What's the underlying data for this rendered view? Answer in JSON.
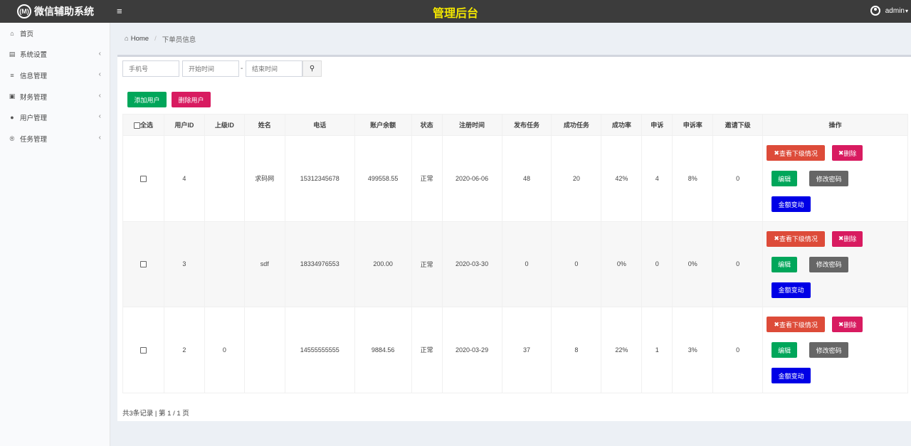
{
  "header": {
    "logo_text": "微信辅助系统",
    "logo_badge": "(M)",
    "title": "管理后台",
    "user": "admin",
    "menu_icon": "hamburger-icon",
    "user_icon": "user-circle-icon",
    "colors": {
      "topbar": "#3c3c3c",
      "title": "#f3e600"
    }
  },
  "sidebar": {
    "items": [
      {
        "label": "首页",
        "icon": "home-icon",
        "has_arrow": false
      },
      {
        "label": "系统设置",
        "icon": "settings-icon",
        "has_arrow": true
      },
      {
        "label": "信息管理",
        "icon": "list-icon",
        "has_arrow": true
      },
      {
        "label": "财务管理",
        "icon": "money-icon",
        "has_arrow": true
      },
      {
        "label": "用户管理",
        "icon": "users-icon",
        "has_arrow": true
      },
      {
        "label": "任务管理",
        "icon": "registered-icon",
        "has_arrow": true
      }
    ]
  },
  "breadcrumb": {
    "home": "Home",
    "current": "下单员信息",
    "separator": "/"
  },
  "filters": {
    "phone_placeholder": "手机号",
    "start_placeholder": "开始时间",
    "end_placeholder": "结束时间",
    "range_dash": "-"
  },
  "actions": {
    "add_user": "添加用户",
    "delete_user": "删除用户"
  },
  "table": {
    "headers": {
      "select_all": "全选",
      "user_id": "用户ID",
      "parent_id": "上级ID",
      "name": "姓名",
      "phone": "电话",
      "balance": "账户余额",
      "status": "状态",
      "reg_time": "注册时间",
      "published": "发布任务",
      "success": "成功任务",
      "success_rate": "成功率",
      "appeals": "申诉",
      "appeal_rate": "申诉率",
      "invites": "邀请下级",
      "ops": "操作"
    },
    "row_buttons": {
      "view_sub": "查看下级情况",
      "delete": "删除",
      "edit": "编辑",
      "change_password": "修改密码",
      "balance_change": "金额变动"
    },
    "rows": [
      {
        "user_id": "4",
        "parent_id": "",
        "name": "求码网",
        "phone": "15312345678",
        "balance": "499558.55",
        "status": "正常",
        "reg_time": "2020-06-06",
        "published": "48",
        "success": "20",
        "success_rate": "42%",
        "appeals": "4",
        "appeal_rate": "8%",
        "invites": "0"
      },
      {
        "user_id": "3",
        "parent_id": "",
        "name": "sdf",
        "phone": "18334976553",
        "balance": "200.00",
        "status": "正常",
        "reg_time": "2020-03-30",
        "published": "0",
        "success": "0",
        "success_rate": "0%",
        "appeals": "0",
        "appeal_rate": "0%",
        "invites": "0"
      },
      {
        "user_id": "2",
        "parent_id": "0",
        "name": "",
        "phone": "14555555555",
        "balance": "9884.56",
        "status": "正常",
        "reg_time": "2020-03-29",
        "published": "37",
        "success": "8",
        "success_rate": "22%",
        "appeals": "1",
        "appeal_rate": "3%",
        "invites": "0"
      }
    ]
  },
  "pagination": {
    "summary": "共3条记录 | 第 1 / 1 页"
  }
}
